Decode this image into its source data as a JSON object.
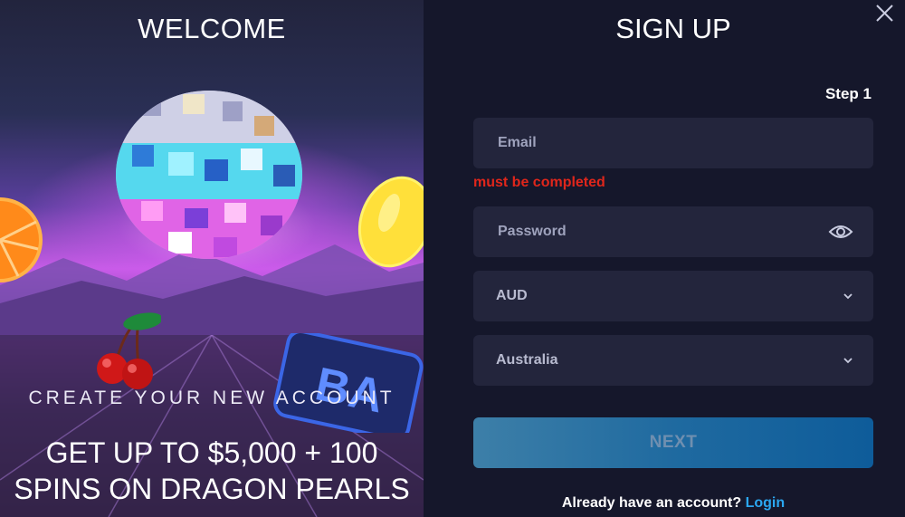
{
  "promo": {
    "title": "WELCOME",
    "subtitle": "CREATE YOUR NEW ACCOUNT",
    "headline_line1": "GET UP TO $5,000 + 100",
    "headline_line2": "SPINS ON DRAGON PEARLS",
    "decor_icons": [
      "disco-ball-icon",
      "lemon-icon",
      "orange-slice-icon",
      "cherries-icon",
      "bar-sign-icon"
    ]
  },
  "form": {
    "title": "SIGN UP",
    "step_label": "Step 1",
    "email": {
      "placeholder": "Email",
      "value": ""
    },
    "email_error": "must be completed",
    "password": {
      "placeholder": "Password",
      "value": ""
    },
    "currency": {
      "selected": "AUD"
    },
    "country": {
      "selected": "Australia"
    },
    "next_label": "NEXT",
    "account_prompt": "Already have an account?",
    "login_label": "Login"
  },
  "icons": {
    "close": "close-icon",
    "password_toggle": "eye-icon",
    "dropdown": "chevron-down-icon"
  },
  "colors": {
    "background": "#15172b",
    "field": "#23253c",
    "error": "#e0261b",
    "link": "#2ba7f0",
    "button_start": "#3d7fa8",
    "button_end": "#0e5c9a"
  }
}
